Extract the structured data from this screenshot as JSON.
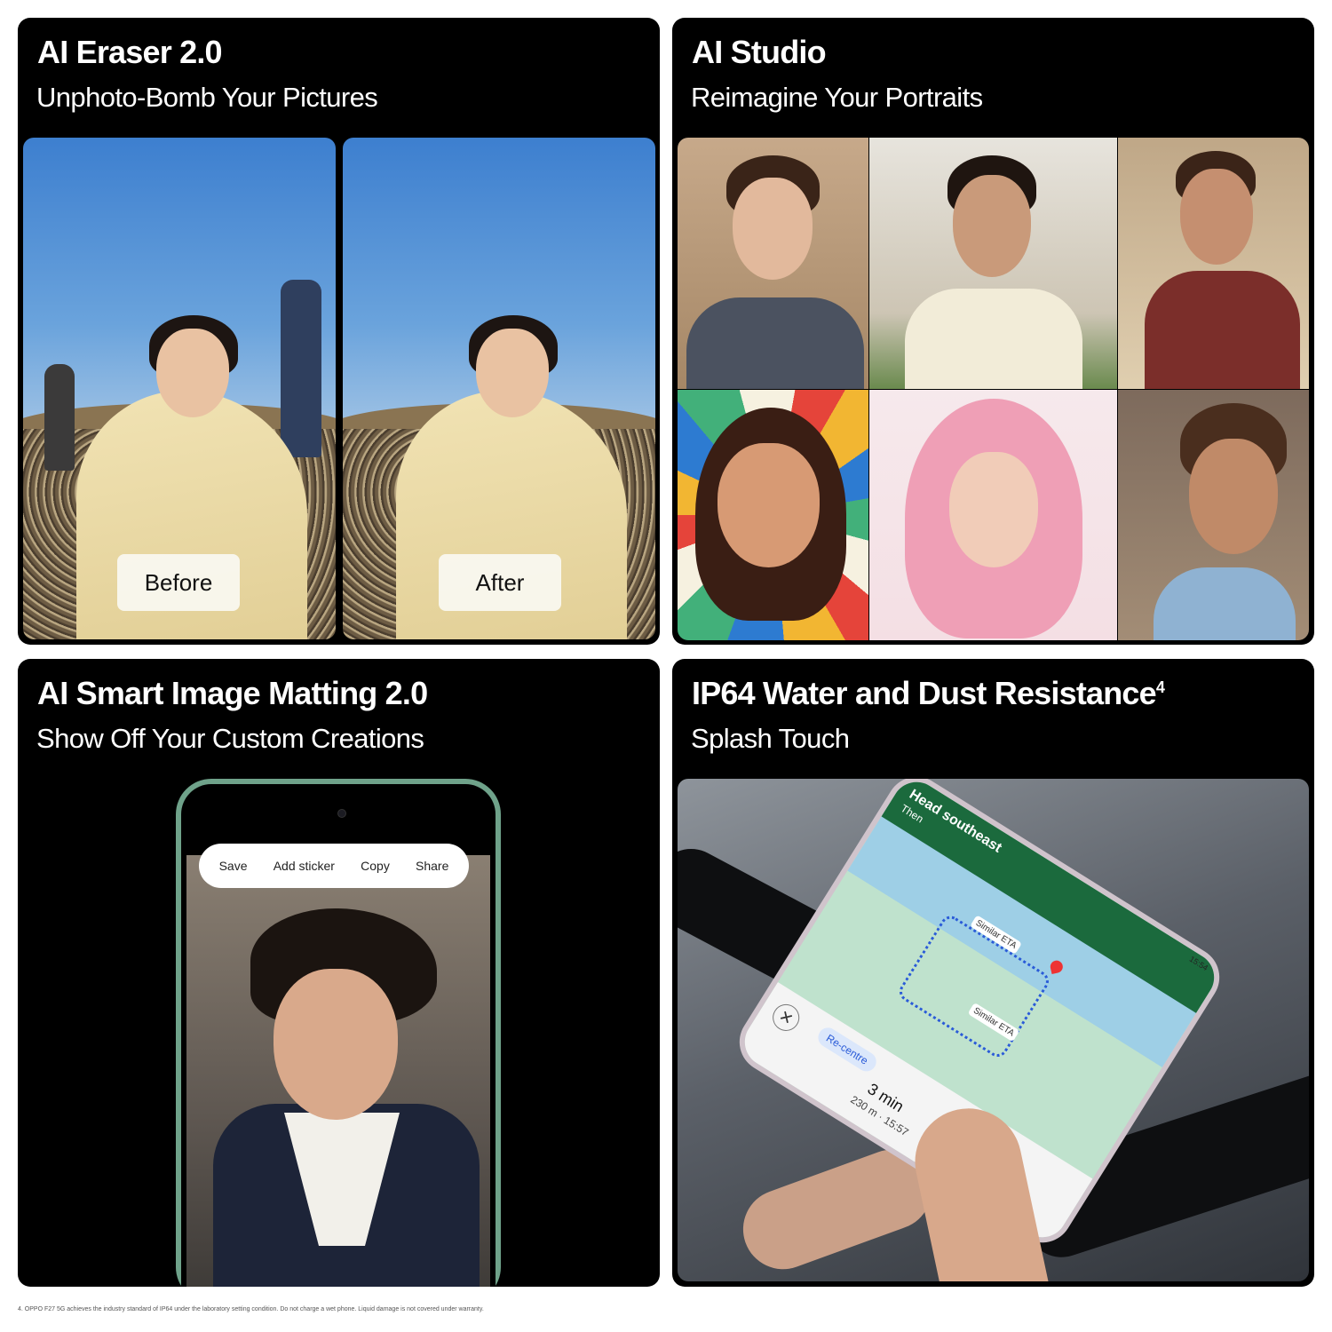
{
  "panels": [
    {
      "title": "AI Eraser 2.0",
      "subtitle": "Unphoto-Bomb Your Pictures",
      "before_label": "Before",
      "after_label": "After"
    },
    {
      "title": "AI Studio",
      "subtitle": "Reimagine Your Portraits"
    },
    {
      "title": "AI Smart Image Matting 2.0",
      "subtitle": "Show Off Your Custom Creations",
      "menu": [
        "Save",
        "Add sticker",
        "Copy",
        "Share"
      ]
    },
    {
      "title": "IP64 Water and Dust Resistance",
      "title_sup": "4",
      "subtitle": "Splash Touch",
      "nav": {
        "status_time": "15:54",
        "instruction": "Head southeast",
        "then": "Then",
        "eta_label_1": "Similar ETA",
        "eta_label_2": "Similar ETA",
        "recentre": "Re-centre",
        "close": "✕",
        "eta_minutes": "3 min",
        "eta_detail": "230 m · 15:57"
      }
    }
  ],
  "footnote": "4. OPPO F27 5G achieves the industry standard of IP64 under the laboratory setting condition. Do not charge a wet phone. Liquid damage is not covered under warranty."
}
